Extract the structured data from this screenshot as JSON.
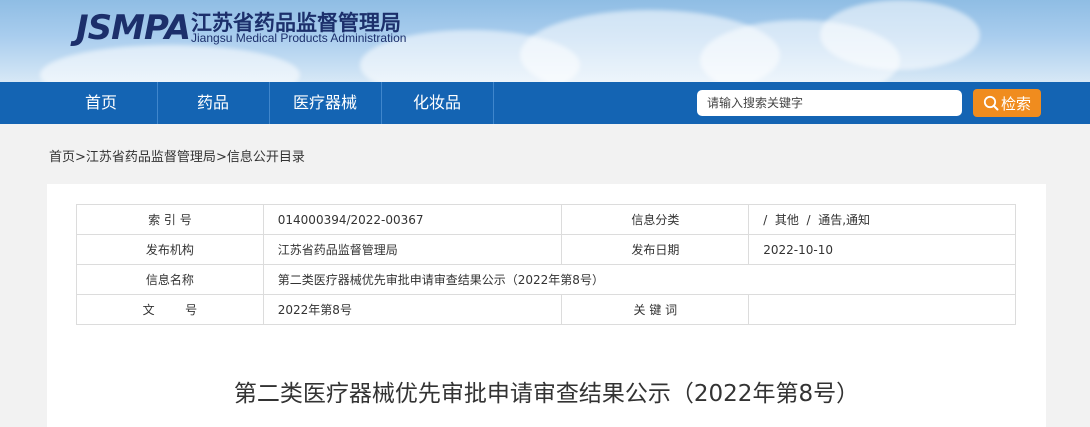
{
  "site": {
    "logo": "JSMPA",
    "name_cn": "江苏省药品监督管理局",
    "name_en": "Jiangsu Medical Products Administration"
  },
  "nav": {
    "items": [
      {
        "label": "首页"
      },
      {
        "label": "药品"
      },
      {
        "label": "医疗器械"
      },
      {
        "label": "化妆品"
      }
    ]
  },
  "search": {
    "placeholder": "请输入搜索关键字",
    "button_label": "检索",
    "button_icon": "search-icon"
  },
  "breadcrumb": {
    "items": [
      "首页",
      "江苏省药品监督管理局",
      "信息公开目录"
    ],
    "separator": ">"
  },
  "info_table": {
    "index_label": "索 引 号",
    "index_value": "014000394/2022-00367",
    "category_label": "信息分类",
    "category_value": "/  其他  /  通告,通知",
    "publisher_label": "发布机构",
    "publisher_value": "江苏省药品监督管理局",
    "date_label": "发布日期",
    "date_value": "2022-10-10",
    "name_label": "信息名称",
    "name_value": "第二类医疗器械优先审批申请审查结果公示（2022年第8号）",
    "docno_label": "文        号",
    "docno_value": "2022年第8号",
    "keywords_label": "关 键 词",
    "keywords_value": ""
  },
  "article": {
    "title": "第二类医疗器械优先审批申请审查结果公示（2022年第8号）"
  },
  "colors": {
    "nav_bg": "#1464b3",
    "search_button": "#f08c1e",
    "logo": "#1c2f6b"
  }
}
